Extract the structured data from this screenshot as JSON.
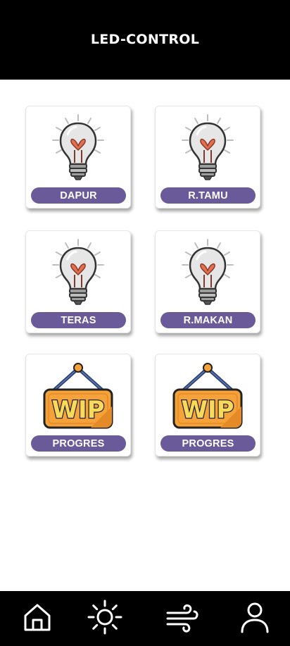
{
  "header": {
    "title": "LED-CONTROL"
  },
  "cards": [
    {
      "label": "DAPUR",
      "icon": "light-bulb-icon"
    },
    {
      "label": "R.TAMU",
      "icon": "light-bulb-icon"
    },
    {
      "label": "TERAS",
      "icon": "light-bulb-icon"
    },
    {
      "label": "R.MAKAN",
      "icon": "light-bulb-icon"
    },
    {
      "label": "PROGRES",
      "icon": "wip-sign-icon",
      "sign_text": "WIP"
    },
    {
      "label": "PROGRES",
      "icon": "wip-sign-icon",
      "sign_text": "WIP"
    }
  ],
  "nav": {
    "items": [
      {
        "icon": "home-icon"
      },
      {
        "icon": "sun-icon"
      },
      {
        "icon": "wind-icon"
      },
      {
        "icon": "user-icon"
      }
    ]
  },
  "colors": {
    "header_bg": "#000000",
    "pill_bg": "#6a5a99",
    "bulb_glass": "#e6e6e6",
    "filament": "#e46f4f",
    "sign_orange": "#f5a23b",
    "sign_text": "#f9d95a",
    "hanger": "#2f4270"
  }
}
